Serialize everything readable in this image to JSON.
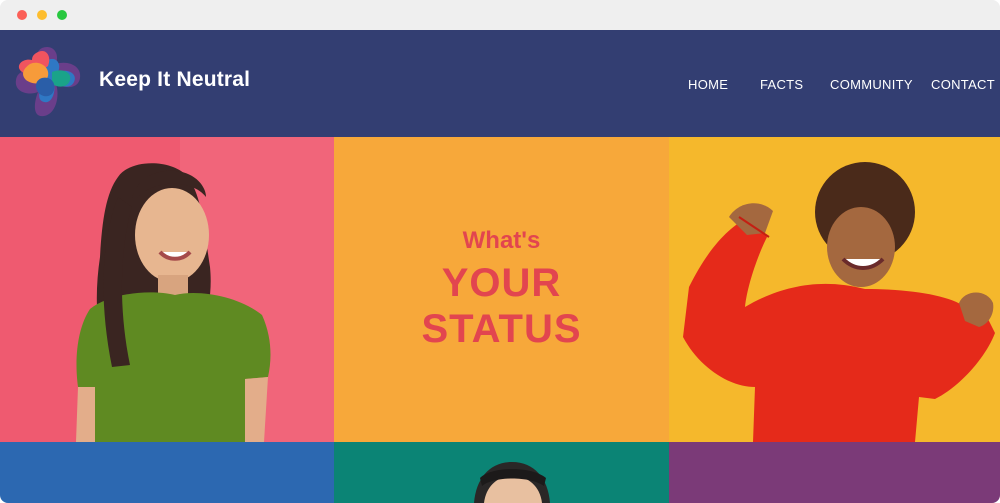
{
  "brand": {
    "name": "Keep It Neutral",
    "logo_icon": "multicolor-cross-logo-icon",
    "header_bg": "#333e72"
  },
  "nav": {
    "items": [
      {
        "label": "HOME"
      },
      {
        "label": "FACTS"
      },
      {
        "label": "COMMUNITY"
      },
      {
        "label": "CONTACT"
      }
    ]
  },
  "hero": {
    "line1": "What's",
    "line2": "YOUR",
    "line3": "STATUS",
    "text_color": "#e2454f"
  },
  "tiles": {
    "colors": [
      "#ef5a70",
      "#f7a83a",
      "#f5b82c",
      "#2c68b1",
      "#0b8475",
      "#7b3a78"
    ]
  }
}
